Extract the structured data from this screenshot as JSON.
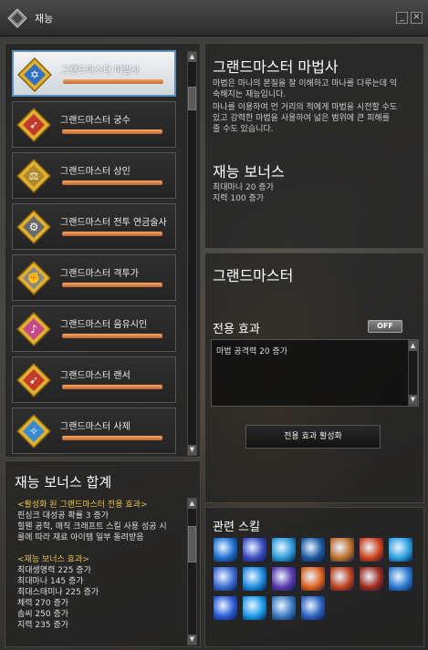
{
  "window": {
    "title": "재능"
  },
  "job_list": {
    "items": [
      {
        "label": "그랜드마스터 마법사",
        "icon": "hexagram-icon",
        "selected": true
      },
      {
        "label": "그랜드마스터 궁수",
        "icon": "bow-icon"
      },
      {
        "label": "그랜드마스터 상인",
        "icon": "scales-icon"
      },
      {
        "label": "그랜드마스터 전투 연금술사",
        "icon": "alchemy-gun-icon"
      },
      {
        "label": "그랜드마스터 격투가",
        "icon": "fist-icon"
      },
      {
        "label": "그랜드마스터 음유시인",
        "icon": "lute-icon"
      },
      {
        "label": "그랜드마스터 랜서",
        "icon": "lance-icon"
      },
      {
        "label": "그랜드마스터 사제",
        "icon": "dove-icon"
      }
    ]
  },
  "bonus_sum": {
    "title": "재능 보너스 합계",
    "lines": [
      {
        "text": "<활성화 된 그랜드마스터 전용 효과>",
        "color": "yellow"
      },
      {
        "text": "핀싱크 대성공 확률 3 증가"
      },
      {
        "text": "힐웬 공학, 매직 크래프트 스킬 사용 성공 시"
      },
      {
        "text": "룰에 따라 재료 아이템 일부 돌려받음"
      },
      {
        "text": ""
      },
      {
        "text": "<재능 보너스 효과>",
        "color": "yellow"
      },
      {
        "text": "최대생명력 225 증가"
      },
      {
        "text": "최대마나 145 증가"
      },
      {
        "text": "최대스태미나 225 증가"
      },
      {
        "text": "체력 270 증가"
      },
      {
        "text": "솜씨 250 증가"
      },
      {
        "text": "지력 235 증가"
      }
    ]
  },
  "detail": {
    "job_title": "그랜드마스터 마법사",
    "description": [
      "마법은 마나의 본질을 잘 이해하고 마나를 다루는데 익",
      "숙해지는 재능입니다.",
      "마나를 이용하여 먼 거리의 적에게 마법을 시전할 수도",
      "있고 강력한 마법을 사용하여 넓은 범위에 큰 피해를",
      "줄 수도 있습니다."
    ],
    "bonus_title": "재능 보너스",
    "bonus_lines": [
      "최대마나 20 증가",
      "지력 100 증가"
    ]
  },
  "grandmaster": {
    "title": "그랜드마스터",
    "exclusive_label": "전용 효과",
    "toggle_label": "OFF",
    "effect_text": "마법 공격력 20 증가",
    "activate_button": "전용 효과 활성화"
  },
  "skills": {
    "title": "관련 스킬",
    "icons": [
      "lightning-icon",
      "thunder-staff-icon",
      "ice-spear-icon",
      "ice-burst-icon",
      "fire-bolt-icon",
      "fireball-icon",
      "ice-crystal-icon",
      "wizard-icon",
      "ice-star-icon",
      "mana-flower-icon",
      "blaze-icon",
      "flame-icon",
      "meteor-icon",
      "snowflake-icon",
      "chain-lightning-icon",
      "blizzard-icon",
      "mana-shield-icon",
      "hexagram-icon"
    ]
  },
  "colors": {
    "selected_border": "#5a8fc0",
    "bar": "#e08a50",
    "highlight_yellow": "#e8c44a"
  }
}
